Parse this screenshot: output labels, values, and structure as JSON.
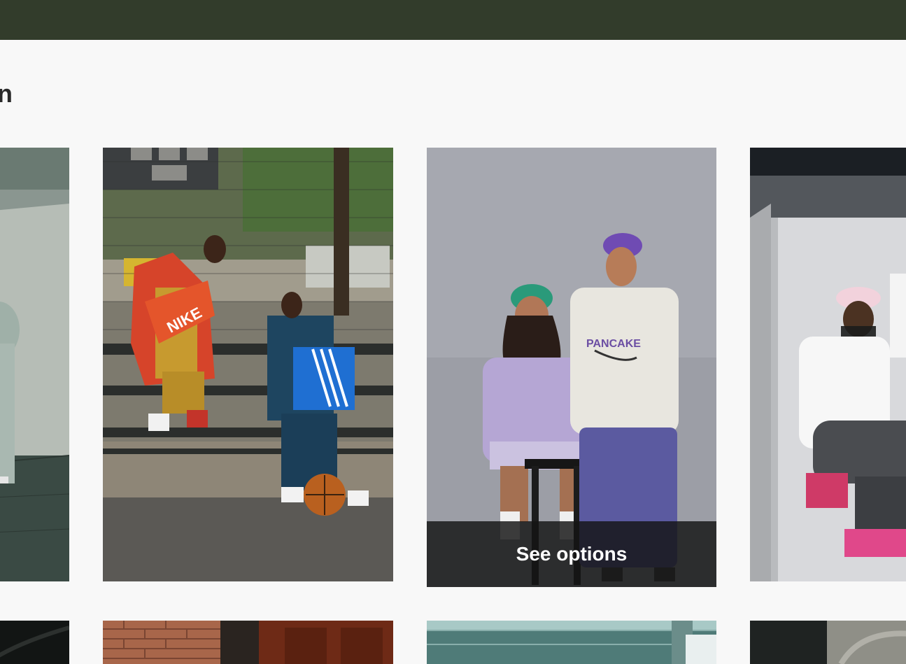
{
  "header": {
    "bar": ""
  },
  "section": {
    "title_fragment": "n"
  },
  "cards": [
    {
      "name": "Photo: person in grey tracksuit by wall"
    },
    {
      "name": "Photo: two men on bench with Nike and adidas boxes"
    },
    {
      "name": "Photo: couple with beanies, purple hoodie",
      "overlay_label": "See options"
    },
    {
      "name": "Photo: woman in pink cap squatting in studio"
    }
  ],
  "colors": {
    "topbar": "#323c2b",
    "overlay": "#141414",
    "page_bg": "#f8f8f8"
  }
}
